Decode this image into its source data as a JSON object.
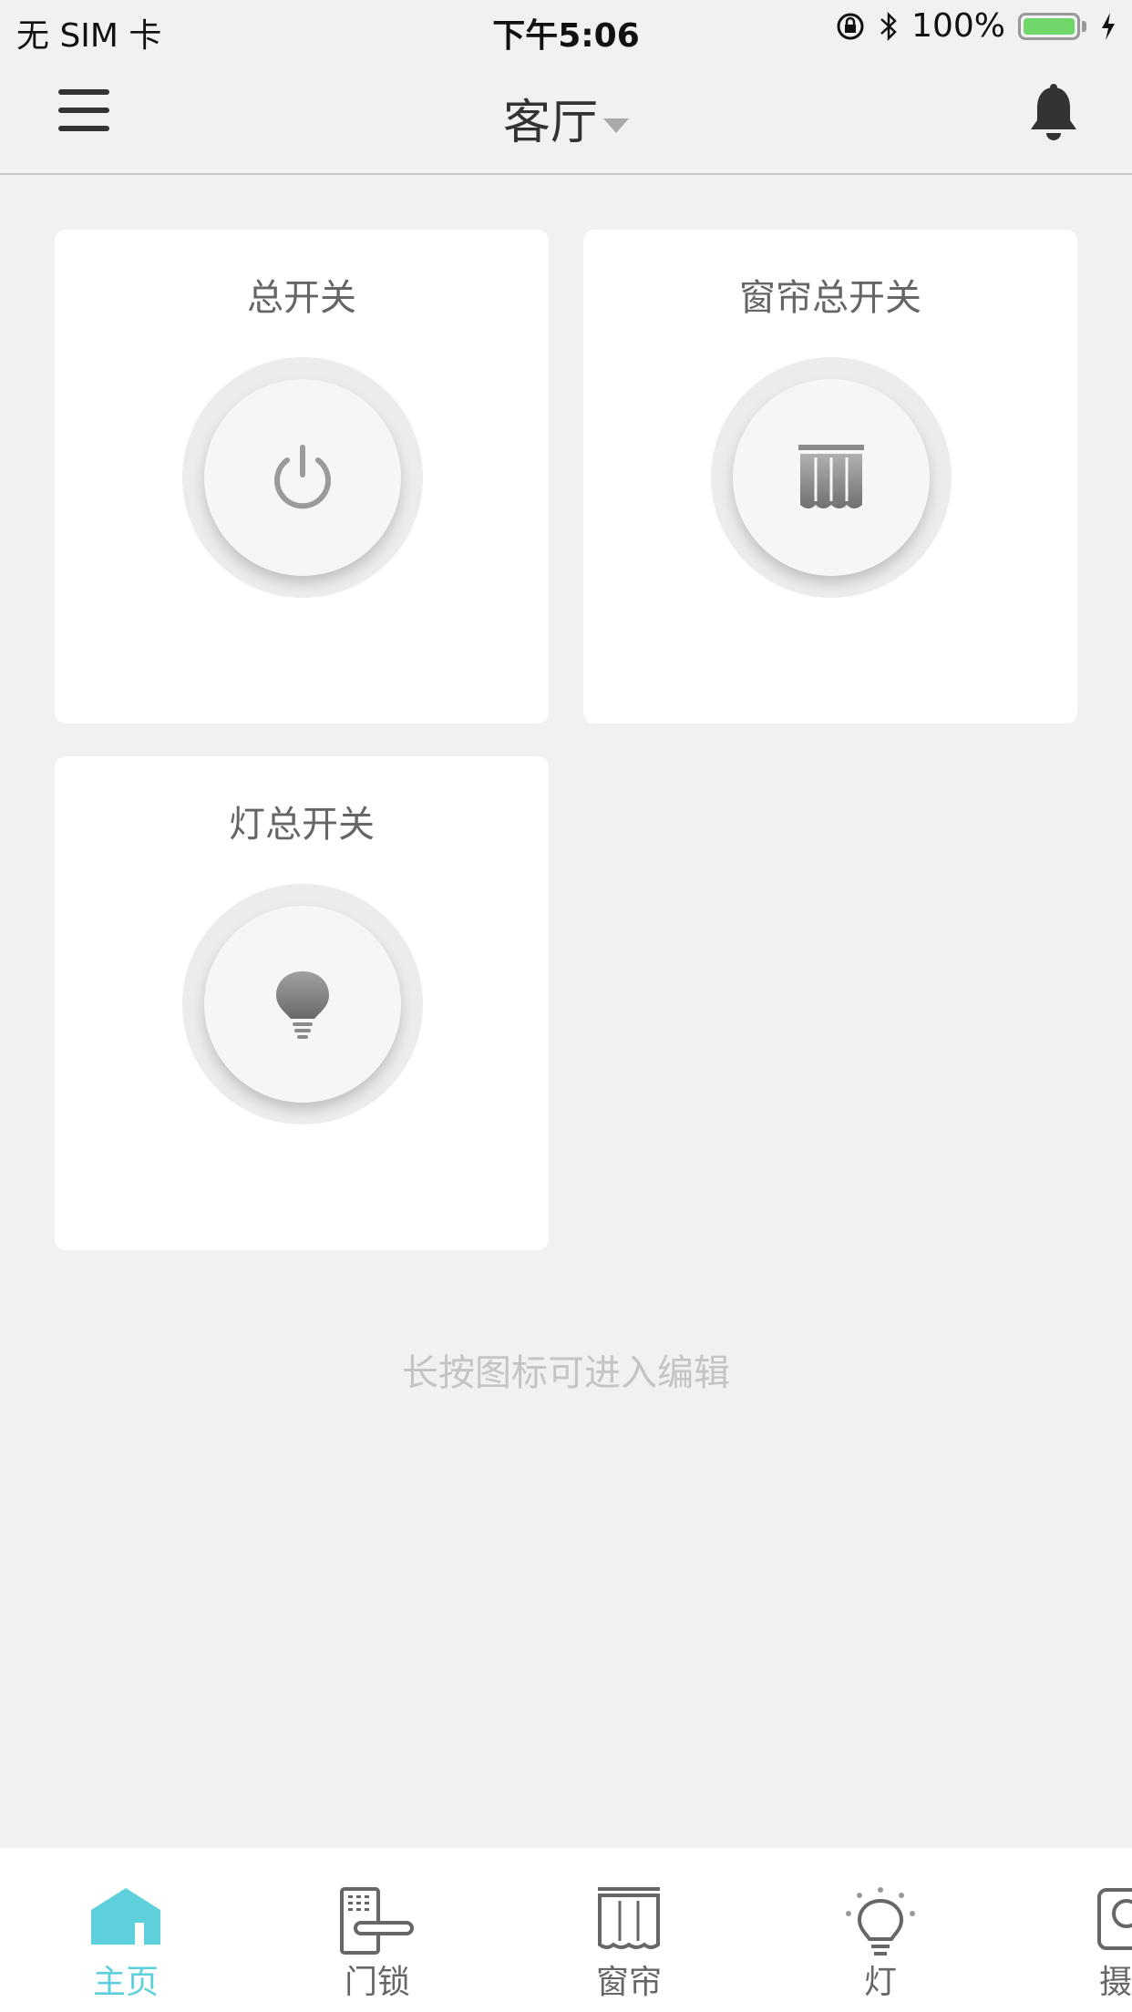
{
  "status_bar": {
    "carrier": "无 SIM 卡",
    "time": "下午5:06",
    "battery_percent": "100%",
    "battery_level": 1.0,
    "battery_color": "#6fd66a"
  },
  "header": {
    "room": "客厅",
    "menu_icon": "hamburger-menu-icon",
    "bell_icon": "bell-icon"
  },
  "cards": [
    {
      "title": "总开关",
      "icon": "power-icon"
    },
    {
      "title": "窗帘总开关",
      "icon": "curtain-icon"
    },
    {
      "title": "灯总开关",
      "icon": "bulb-icon"
    }
  ],
  "hint": "长按图标可进入编辑",
  "tabs": [
    {
      "label": "主页",
      "icon": "home-icon",
      "active": true
    },
    {
      "label": "门锁",
      "icon": "door-lock-icon",
      "active": false
    },
    {
      "label": "窗帘",
      "icon": "curtain-icon",
      "active": false
    },
    {
      "label": "灯",
      "icon": "bulb-icon",
      "active": false
    },
    {
      "label": "摄像",
      "icon": "camera-icon",
      "active": false
    }
  ],
  "colors": {
    "accent": "#5dd0dc",
    "background": "#f1f1f1",
    "icon_gray": "#8a8a8a"
  }
}
